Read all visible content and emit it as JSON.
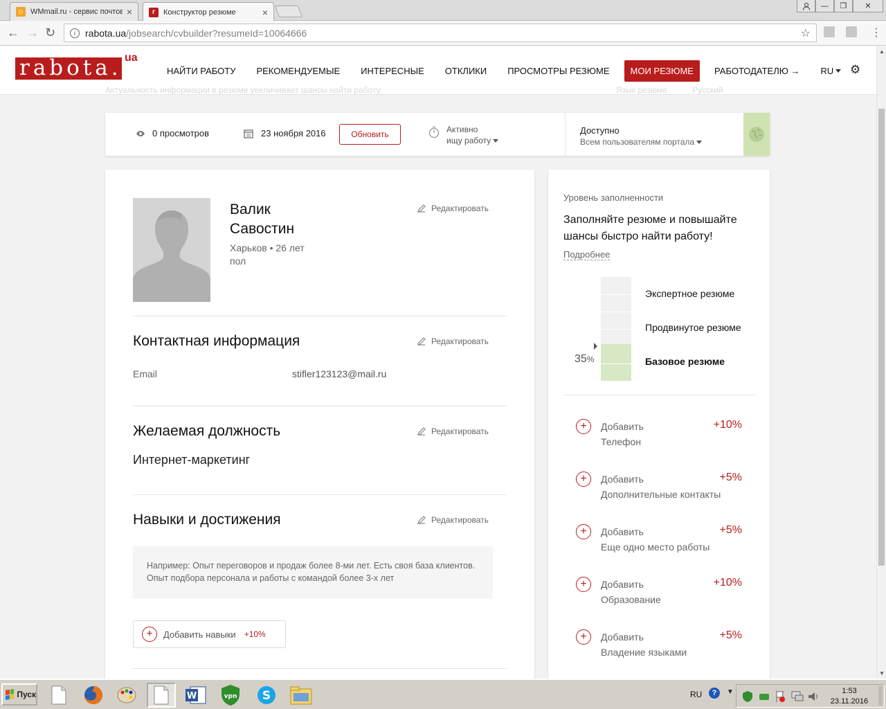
{
  "browser": {
    "tabs": [
      {
        "title": "WMmail.ru - сервис почтов",
        "close": "×"
      },
      {
        "title": "Конструктор резюме",
        "close": "×"
      }
    ],
    "url_host": "rabota.ua",
    "url_path": "/jobsearch/cvbuilder?resumeId=10064666",
    "window_buttons": [
      "—",
      "❐",
      "✕"
    ]
  },
  "header": {
    "logo": "rabota.",
    "logo_suffix": "ua",
    "nav": [
      "НАЙТИ РАБОТУ",
      "РЕКОМЕНДУЕМЫЕ",
      "ИНТЕРЕСНЫЕ",
      "ОТКЛИКИ",
      "ПРОСМОТРЫ РЕЗЮМЕ",
      "МОИ РЕЗЮМЕ",
      "РАБОТОДАТЕЛЮ →",
      "RU"
    ],
    "active_nav": "МОИ РЕЗЮМЕ",
    "ghost_subtitle": "Актуальность информации в резюме увеличивает шансы найти работу.",
    "ghost_lang_label": "Язык резюме",
    "ghost_lang_value": "Русский"
  },
  "status_bar": {
    "views": "0 просмотров",
    "date": "23 ноября 2016",
    "update_button": "Обновить",
    "search_status_line1": "Активно",
    "search_status_line2": "ищу работу",
    "access_title": "Доступно",
    "access_value": "Всем пользователям портала"
  },
  "resume": {
    "first_name": "Валик",
    "last_name": "Савостин",
    "city_age": "Харьков • 26 лет",
    "gender": "пол",
    "edit_label": "Редактировать",
    "contact_title": "Контактная информация",
    "email_label": "Email",
    "email_value": "stifler123123@mail.ru",
    "position_title": "Желаемая должность",
    "position_value": "Интернет-маркетинг",
    "skills_title": "Навыки и достижения",
    "skills_example": "Например: Опыт переговоров и продаж более 8-ми лет. Есть своя база клиентов. Опыт подбора персонала и работы с командой более 3-х лет",
    "add_skills_label": "Добавить навыки",
    "add_skills_pct": "+10%"
  },
  "sidebar": {
    "level_title": "Уровень заполненности",
    "promo": "Заполняйте резюме и повышайте шансы быстро найти работу!",
    "more_link": "Подробнее",
    "fill_percent": 35,
    "fill_percent_label": "35",
    "fill_percent_sign": "%",
    "levels": [
      "Экспертное резюме",
      "Продвинутое резюме",
      "Базовое резюме"
    ],
    "current_level": "Базовое резюме",
    "add_label": "Добавить",
    "items": [
      {
        "label": "Телефон",
        "pct": "+10%"
      },
      {
        "label": "Дополнительные контакты",
        "pct": "+5%"
      },
      {
        "label": "Еще одно место работы",
        "pct": "+5%"
      },
      {
        "label": "Образование",
        "pct": "+10%"
      },
      {
        "label": "Владение языками",
        "pct": "+5%"
      }
    ]
  },
  "taskbar": {
    "start": "Пуск",
    "lang": "RU",
    "time": "1:53",
    "date": "23.11.2016"
  },
  "colors": {
    "brand": "#b91c1c",
    "meter_fill": "#d7e8c4",
    "globe_box": "#cfe3b2"
  }
}
